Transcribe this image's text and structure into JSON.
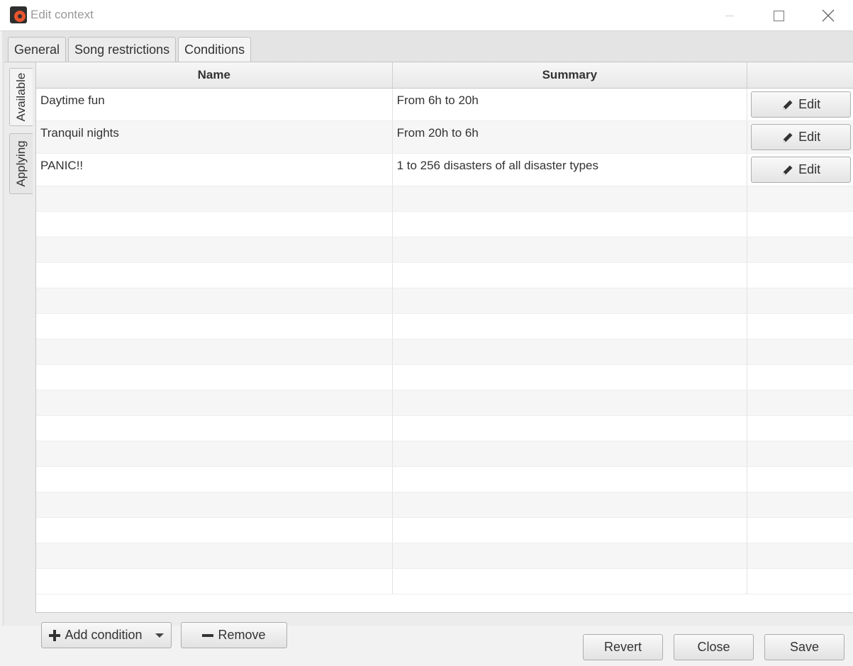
{
  "window": {
    "title": "Edit context"
  },
  "tabs": [
    {
      "label": "General"
    },
    {
      "label": "Song restrictions"
    },
    {
      "label": "Conditions"
    }
  ],
  "side_tabs": [
    {
      "label": "Available"
    },
    {
      "label": "Applying"
    }
  ],
  "table": {
    "columns": [
      "Name",
      "Summary",
      ""
    ],
    "rows": [
      {
        "name": "Daytime fun",
        "summary": "From 6h to 20h",
        "action": "Edit"
      },
      {
        "name": "Tranquil nights",
        "summary": "From 20h to 6h",
        "action": "Edit"
      },
      {
        "name": "PANIC!!",
        "summary": "1 to 256 disasters of all disaster types",
        "action": "Edit"
      }
    ]
  },
  "actions": {
    "add_label": "Add condition",
    "remove_label": "Remove"
  },
  "footer": {
    "revert_label": "Revert",
    "close_label": "Close",
    "save_label": "Save"
  },
  "icons": {
    "app": "record-disc-icon",
    "edit": "pencil-icon",
    "add": "plus-icon",
    "remove": "minus-icon"
  }
}
